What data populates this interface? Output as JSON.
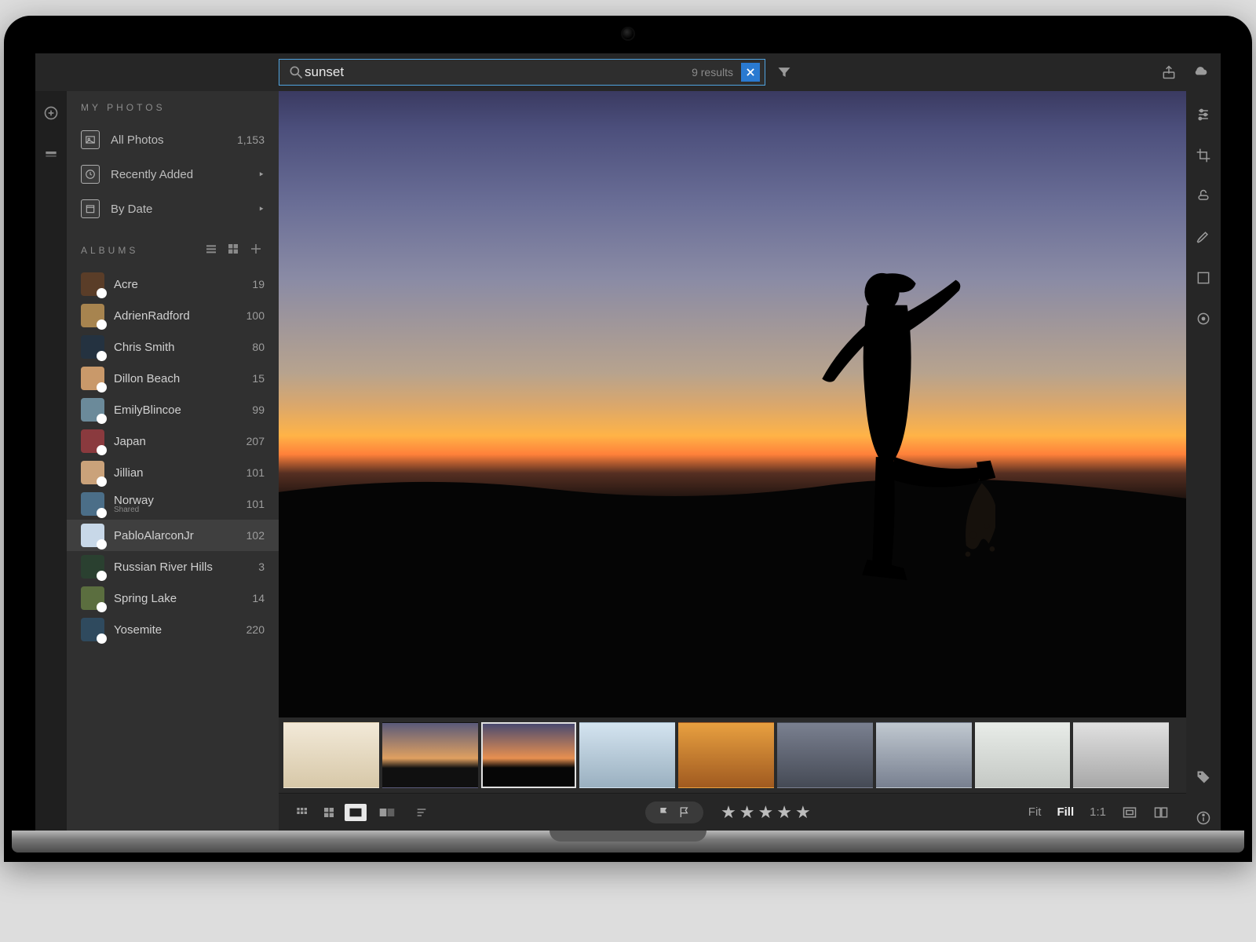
{
  "search": {
    "value": "sunset",
    "results_label": "9 results"
  },
  "sidebar": {
    "my_photos_title": "MY PHOTOS",
    "albums_title": "ALBUMS",
    "nav": [
      {
        "label": "All Photos",
        "count": "1,153",
        "icon": "image"
      },
      {
        "label": "Recently Added",
        "count": "",
        "icon": "clock",
        "chev": true
      },
      {
        "label": "By Date",
        "count": "",
        "icon": "calendar",
        "chev": true
      }
    ],
    "albums": [
      {
        "name": "Acre",
        "count": "19",
        "color": "#5a3d28"
      },
      {
        "name": "AdrienRadford",
        "count": "100",
        "color": "#a7844f"
      },
      {
        "name": "Chris Smith",
        "count": "80",
        "color": "#243240"
      },
      {
        "name": "Dillon Beach",
        "count": "15",
        "color": "#c9996a"
      },
      {
        "name": "EmilyBlincoe",
        "count": "99",
        "color": "#6b8a9a"
      },
      {
        "name": "Japan",
        "count": "207",
        "color": "#8a3a3e"
      },
      {
        "name": "Jillian",
        "count": "101",
        "color": "#caa27a"
      },
      {
        "name": "Norway",
        "sub": "Shared",
        "count": "101",
        "color": "#4b6e88"
      },
      {
        "name": "PabloAlarconJr",
        "count": "102",
        "color": "#c8d8e8",
        "selected": true
      },
      {
        "name": "Russian River Hills",
        "count": "3",
        "color": "#2a4030"
      },
      {
        "name": "Spring Lake",
        "count": "14",
        "color": "#5b6e3f"
      },
      {
        "name": "Yosemite",
        "count": "220",
        "color": "#2f4a5e"
      }
    ]
  },
  "filmstrip_thumbs": [
    {
      "bg": "linear-gradient(#f2e9d8,#d7c8a8)"
    },
    {
      "bg": "linear-gradient(#5a5a7a 0%,#e0a060 55%,#101010 70%)"
    },
    {
      "bg": "linear-gradient(#4a4a70 0%,#e89050 55%,#060606 70%)",
      "selected": true
    },
    {
      "bg": "linear-gradient(#d4e4f0,#9ab0c0)"
    },
    {
      "bg": "linear-gradient(#e8a040,#a05a20)"
    },
    {
      "bg": "linear-gradient(#7a8090,#454a55)"
    },
    {
      "bg": "linear-gradient(#c0c8d0,#788090)"
    },
    {
      "bg": "linear-gradient(#e8ece8,#c4c8c4)"
    },
    {
      "bg": "linear-gradient(#e0e0e0,#a8a8a8)"
    }
  ],
  "bottombar": {
    "rating_stars": 5,
    "zoom": {
      "fit": "Fit",
      "fill": "Fill",
      "one": "1:1",
      "active": "fill"
    }
  }
}
